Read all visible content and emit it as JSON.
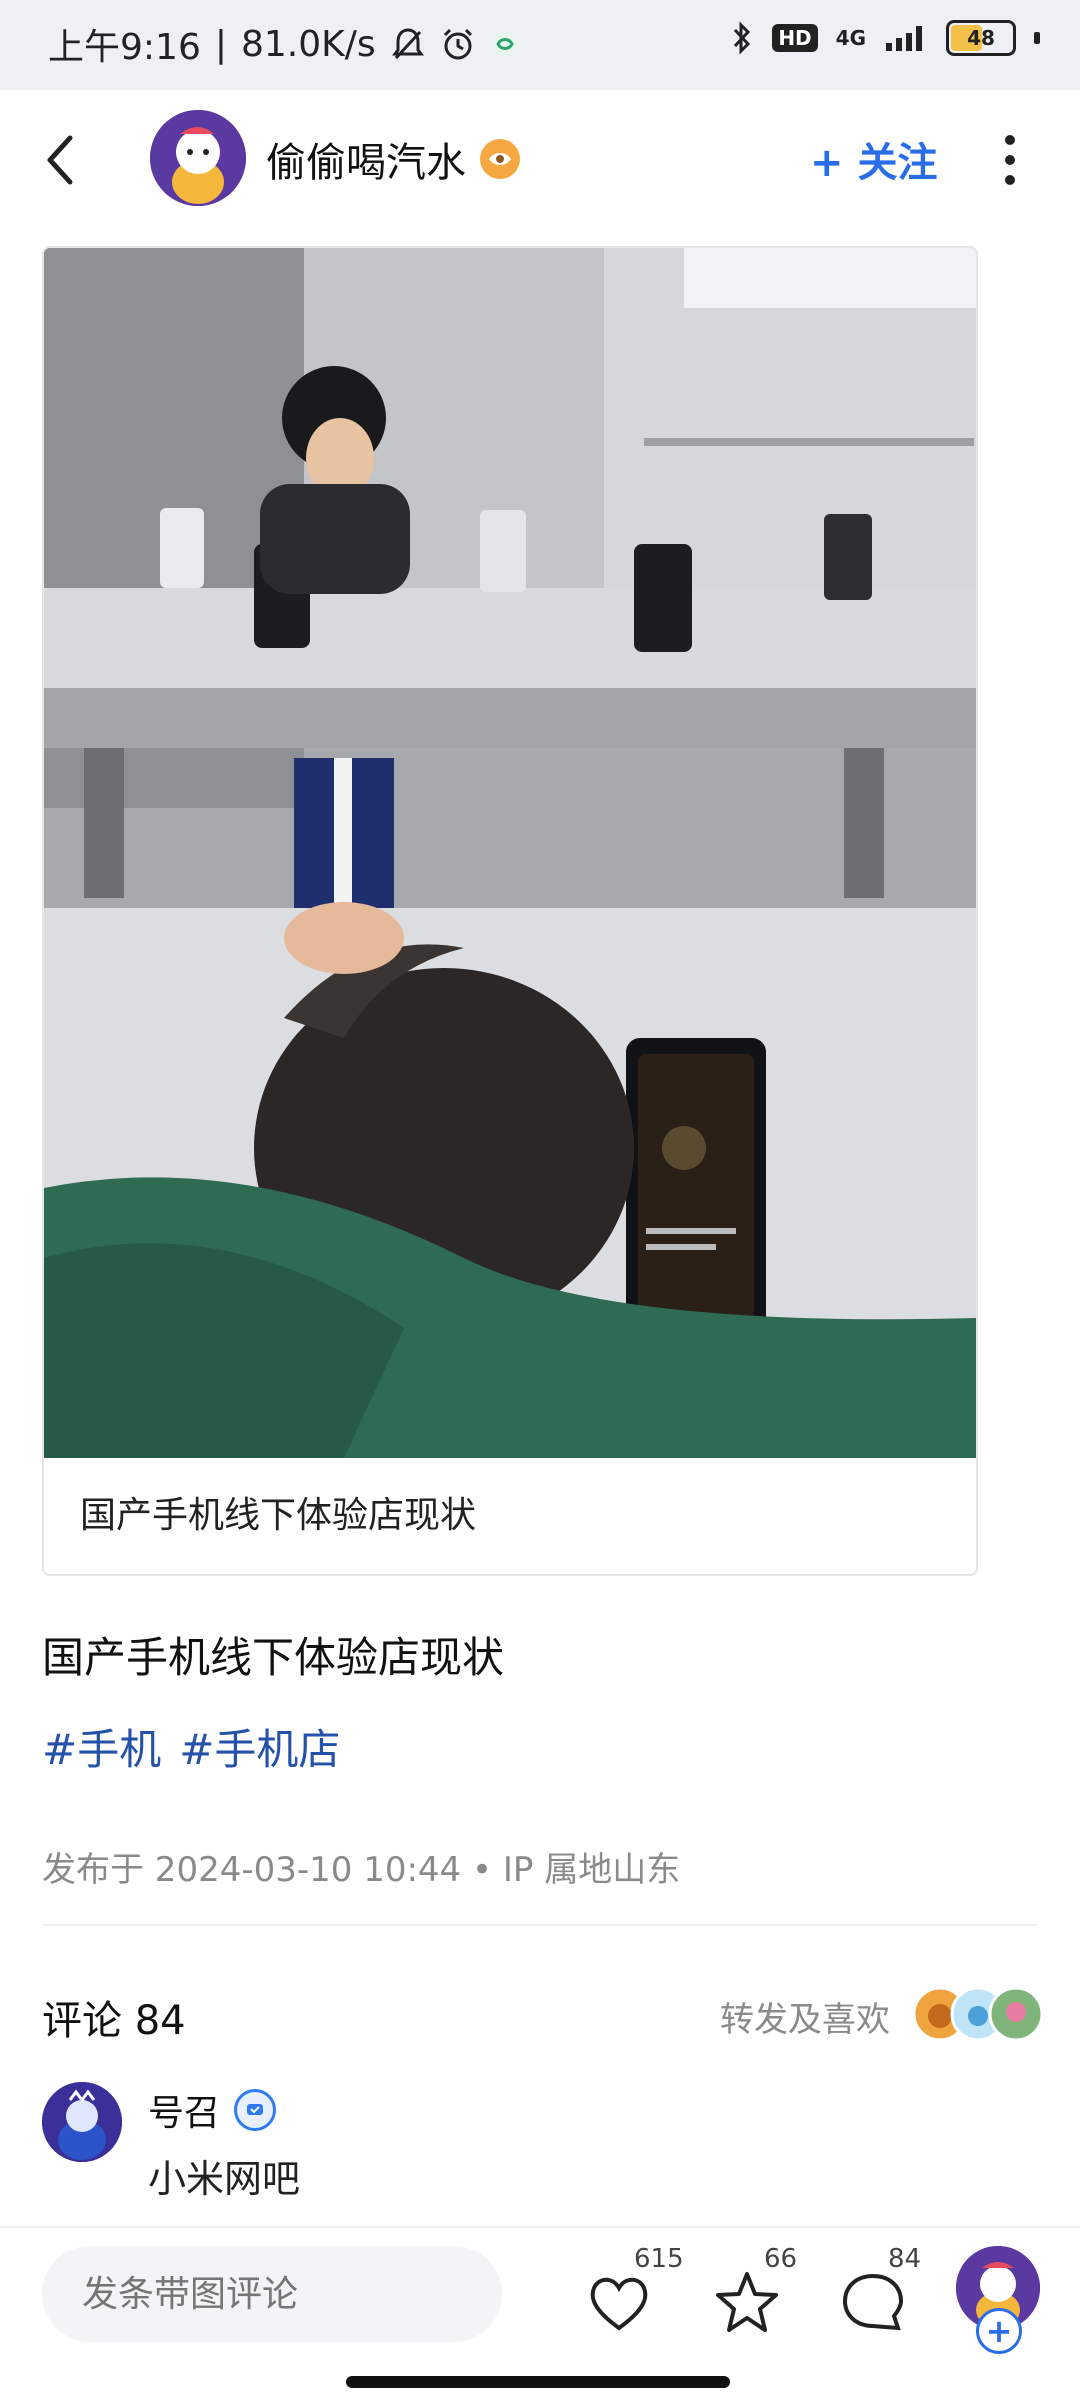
{
  "status_bar": {
    "time": "上午9:16",
    "speed": "81.0K/s",
    "network": "4G",
    "hd": "HD",
    "battery": "48"
  },
  "header": {
    "username": "偷偷喝汽水",
    "follow_label": "+ 关注"
  },
  "post": {
    "image_caption": "国产手机线下体验店现状",
    "title": "国产手机线下体验店现状",
    "tags": [
      "#手机",
      "#手机店"
    ],
    "meta": "发布于 2024-03-10 10:44 • IP 属地山东"
  },
  "comments": {
    "title": "评论 84",
    "share_likes_label": "转发及喜欢",
    "items": [
      {
        "author": "号召",
        "text": "小米网吧"
      }
    ]
  },
  "bottom_bar": {
    "input_placeholder": "发条带图评论",
    "like_count": "615",
    "star_count": "66",
    "comment_count": "84"
  },
  "colors": {
    "accent": "#2a6de8",
    "tag": "#2452a8",
    "meta": "#8a8a8a"
  }
}
